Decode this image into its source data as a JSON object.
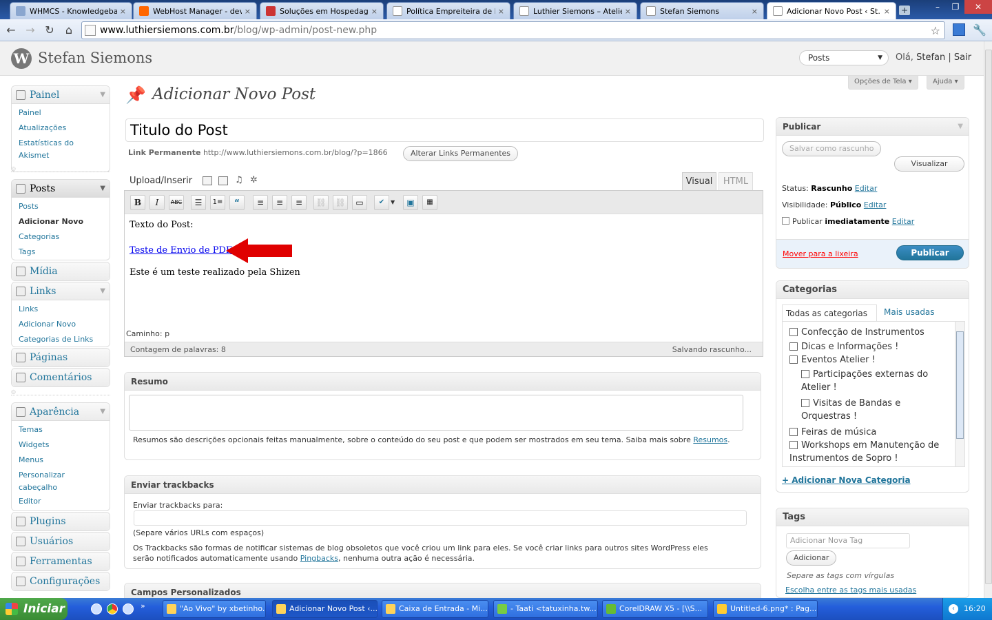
{
  "browser": {
    "tabs": [
      {
        "title": "WHMCS - Knowledgebase",
        "active": false
      },
      {
        "title": "WebHost Manager - dev-...",
        "active": false
      },
      {
        "title": "Soluções em Hospedage...",
        "active": false
      },
      {
        "title": "Política Empreiteira de M...",
        "active": false
      },
      {
        "title": "Luthier Siemons – Atelier ...",
        "active": false
      },
      {
        "title": "Stefan Siemons",
        "active": false
      },
      {
        "title": "Adicionar Novo Post ‹ St...",
        "active": true
      }
    ],
    "url_host": "www.luthiersiemons.com.br",
    "url_path": "/blog/wp-admin/post-new.php"
  },
  "header": {
    "site_name": "Stefan Siemons",
    "favorites_selected": "Posts",
    "greeting": "Olá,",
    "user": "Stefan",
    "divider": "|",
    "logout": "Sair"
  },
  "screen_meta": {
    "options_label": "Opções de Tela",
    "help_label": "Ajuda"
  },
  "menu": {
    "painel": {
      "label": "Painel",
      "items": [
        "Painel",
        "Atualizações",
        "Estatísticas do",
        "Akismet"
      ]
    },
    "posts": {
      "label": "Posts",
      "items": [
        "Posts",
        "Adicionar Novo",
        "Categorias",
        "Tags"
      ]
    },
    "midia": "Mídia",
    "links": {
      "label": "Links",
      "items": [
        "Links",
        "Adicionar Novo",
        "Categorias de Links"
      ]
    },
    "paginas": "Páginas",
    "comentarios": "Comentários",
    "aparencia": {
      "label": "Aparência",
      "items": [
        "Temas",
        "Widgets",
        "Menus",
        "Personalizar",
        "cabeçalho",
        "Editor"
      ]
    },
    "plugins": "Plugins",
    "usuarios": "Usuários",
    "ferramentas": "Ferramentas",
    "configuracoes": "Configurações"
  },
  "page": {
    "title": "Adicionar Novo Post",
    "post_title": "Titulo do Post",
    "permalink_label": "Link Permanente",
    "permalink_url": "http://www.luthiersiemons.com.br/blog/?p=1866",
    "change_permalink": "Alterar Links Permanentes",
    "upload_label": "Upload/Inserir",
    "tab_visual": "Visual",
    "tab_html": "HTML",
    "content_line1": "Texto do Post:",
    "content_link": "Teste de Envio de PDF",
    "content_line2": "Este é um teste realizado pela Shizen",
    "path_label": "Caminho: p",
    "word_count": "Contagem de palavras: 8",
    "saving": "Salvando rascunho..."
  },
  "resumo": {
    "title": "Resumo",
    "help": "Resumos são descrições opcionais feitas manualmente, sobre o conteúdo do seu post e que podem ser mostrados em seu tema. Saiba mais sobre",
    "link": "Resumos",
    "end": "."
  },
  "trackbacks": {
    "title": "Enviar trackbacks",
    "label": "Enviar trackbacks para:",
    "hint": "(Separe vários URLs com espaços)",
    "desc1": "Os Trackbacks são formas de notificar sistemas de blog obsoletos que você criou um link para eles. Se você criar links para outros sites WordPress eles",
    "desc2": "serão notificados automaticamente usando",
    "link": "Pingbacks",
    "desc3": ", nenhuma outra ação é necessária."
  },
  "custom_fields": {
    "title": "Campos Personalizados"
  },
  "publish": {
    "title": "Publicar",
    "save_draft": "Salvar como rascunho",
    "preview": "Visualizar",
    "status_label": "Status:",
    "status_value": "Rascunho",
    "visibility_label": "Visibilidade:",
    "visibility_value": "Público",
    "publish_label": "Publicar",
    "publish_value": "imediatamente",
    "edit": "Editar",
    "trash": "Mover para a lixeira",
    "publish_button": "Publicar"
  },
  "categories": {
    "title": "Categorias",
    "tab_all": "Todas as categorias",
    "tab_used": "Mais usadas",
    "items": [
      "Confecção de Instrumentos",
      "Dicas e Informações !",
      "Eventos Atelier !",
      "Participações externas do",
      "Atelier !",
      "Visitas de Bandas e",
      "Orquestras !",
      "Feiras de música",
      "Workshops em Manutenção de",
      "Instrumentos de Sopro !"
    ],
    "add_new": "+ Adicionar Nova Categoria"
  },
  "tags": {
    "title": "Tags",
    "placeholder": "Adicionar Nova Tag",
    "add_button": "Adicionar",
    "hint": "Separe as tags com vírgulas",
    "choose": "Escolha entre as tags mais usadas"
  },
  "taskbar": {
    "start": "Iniciar",
    "tasks": [
      "\"Ao Vivo\" by xbetinho...",
      "Adicionar Novo Post ‹...",
      "Caixa de Entrada - Mi...",
      "- Taati <tatuxinha.tw...",
      "CorelDRAW X5 - [\\\\S...",
      "Untitled-6.png* : Pag..."
    ],
    "clock": "16:20"
  },
  "colors": {
    "link": "#21759b",
    "publish_button": "#21759b",
    "annotation_arrow": "#e00000",
    "taskbar": "#245edb"
  }
}
